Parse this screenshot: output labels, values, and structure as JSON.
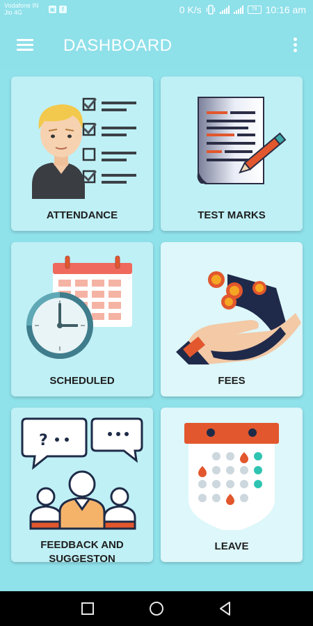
{
  "status_bar": {
    "carrier_line1": "Vodafone IN",
    "carrier_line2": "Jio 4G",
    "speed": "0 K/s",
    "battery": "78",
    "time": "10:16 am"
  },
  "app_bar": {
    "title": "DASHBOARD"
  },
  "cards": [
    {
      "label": "ATTENDANCE"
    },
    {
      "label": "TEST MARKS"
    },
    {
      "label": "SCHEDULED"
    },
    {
      "label": "FEES"
    },
    {
      "label_line1": "FEEDBACK AND",
      "label_line2": "SUGGESTON"
    },
    {
      "label": "LEAVE"
    }
  ],
  "nav_bar": {
    "icons": [
      "recents-square-icon",
      "home-circle-icon",
      "back-triangle-icon"
    ]
  },
  "colors": {
    "primary": "#8ee0e9",
    "card_dark": "#bff0f5",
    "card_light": "#ddf7fa"
  }
}
